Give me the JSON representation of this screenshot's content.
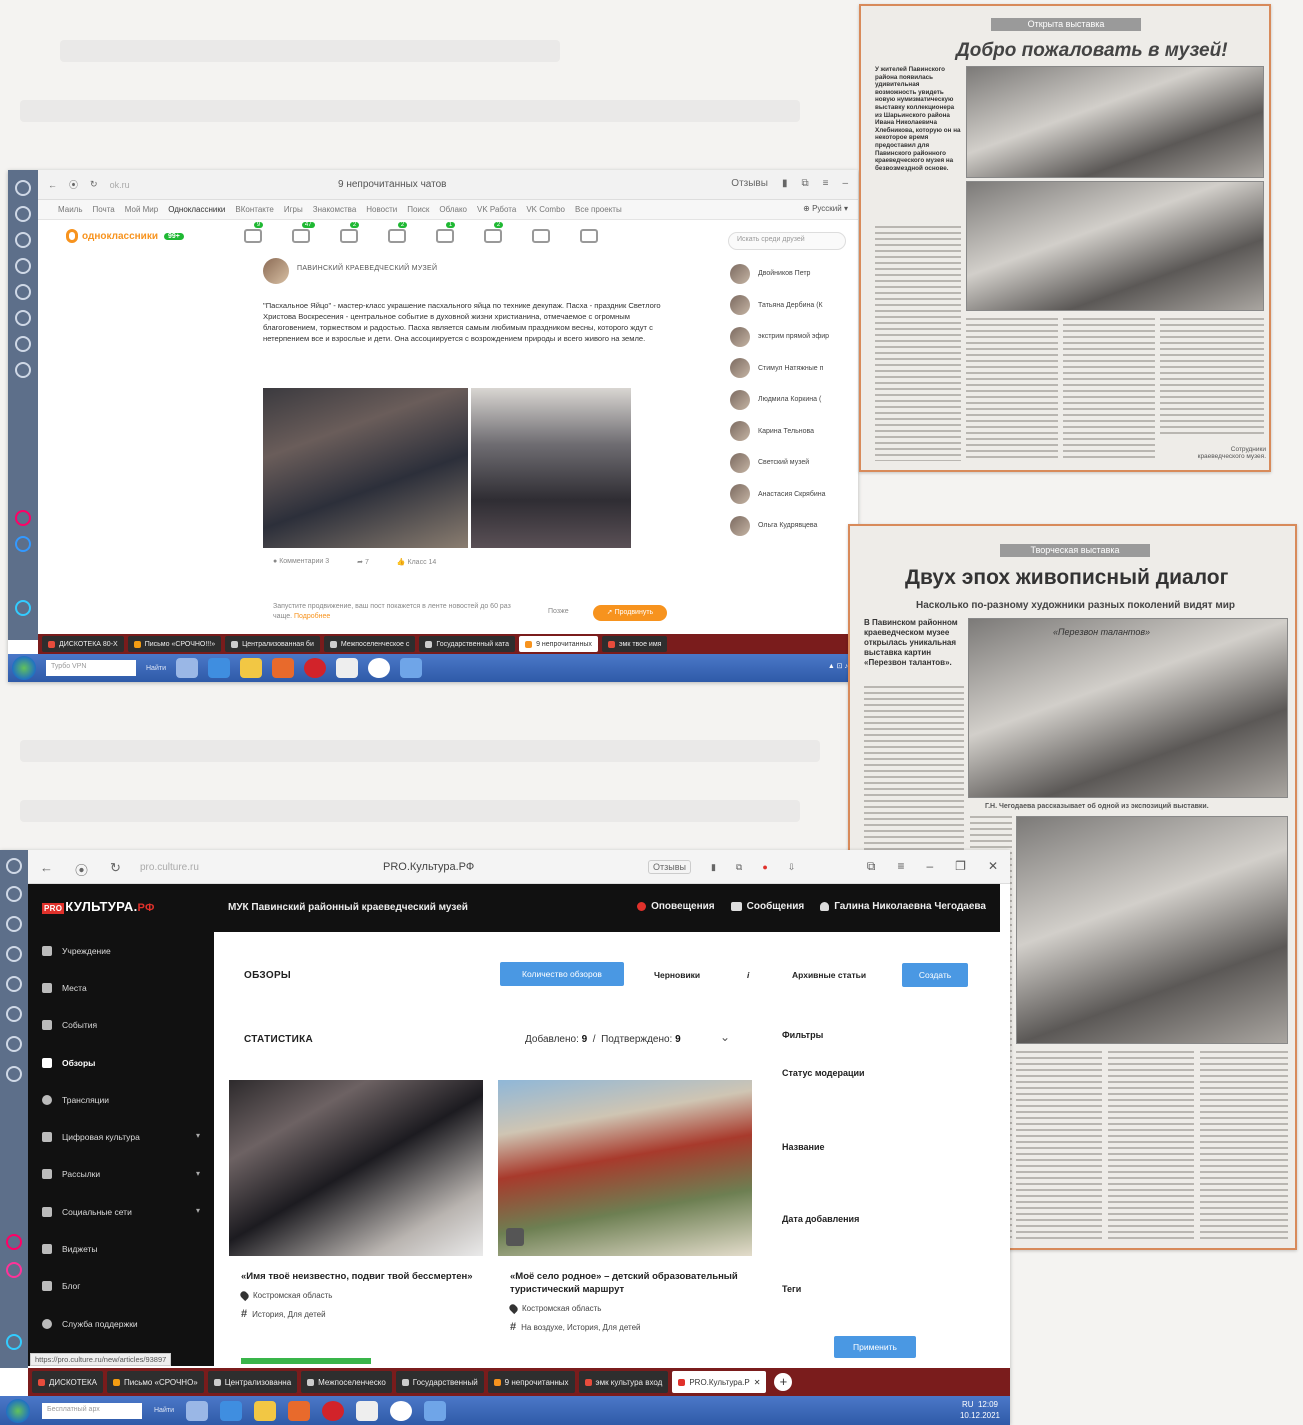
{
  "shot1": {
    "tab_title": "9 непрочитанных чатов",
    "url": "ok.ru",
    "reviews": "Отзывы",
    "bookmarks": [
      "Маиль",
      "Почта",
      "Мой Мир",
      "Одноклассники",
      "ВКонтакте",
      "Игры",
      "Знакомства",
      "Новости",
      "Поиск",
      "Облако",
      "VK Работа",
      "VK Combo",
      "Все проекты"
    ],
    "language": "Русский",
    "logo_text": "одноклассники",
    "logo_badge": "99+",
    "nav_badges": [
      "9",
      "47",
      "2",
      "2",
      "1",
      "2"
    ],
    "search_placeholder": "Искать среди друзей",
    "post_author": "ПАВИНСКИЙ КРАЕВЕДЧЕСКИЙ МУЗЕЙ",
    "post_text": "\"Пасхальное Яйцо\" - мастер-класс украшение пасхального яйца по технике декупаж. Пасха - праздник Светлого Христова Воскресения - центральное событие в духовной жизни христианина, отмечаемое с огромным благоговением, торжеством и радостью. Пасха является самым любимым праздником весны, которого ждут с нетерпением все и взрослые и дети. Она ассоциируется с возрождением природы и всего живого на земле.",
    "post_actions": {
      "comments": "Комментарии 3",
      "share": "7",
      "likes": "Класс 14"
    },
    "promo_text": "Запустите продвижение, ваш пост покажется в ленте новостей до 60 раз чаще.",
    "promo_more": "Подробнее",
    "promo_later": "Позже",
    "promo_button": "Продвинуть",
    "friends": [
      "Двойников Петр",
      "Татьяна Дербина (К",
      "экстрим прямой эфир",
      "Стимул Натяжные п",
      "Людмила Коркина (",
      "Карина Тельнова",
      "Светский музей",
      "Анастасия Скрябина",
      "Ольга Кудрявцева"
    ],
    "taskbar_tabs": [
      "ДИСКОТЕКА 80-Х",
      "Письмо «СРОЧНО!!!»",
      "Централизованная би",
      "Межпоселенческое с",
      "Государственный ката",
      "9 непрочитанных",
      "эмк твое имя"
    ],
    "win_search": "Турбо VPN",
    "win_find": "Найти"
  },
  "clip1": {
    "kicker": "Открыта выставка",
    "title": "Добро пожаловать в музей!",
    "lead": "У жителей Павинского района появилась удивительная возможность увидеть новую нумизматическую выставку коллекционера из Шарьинского района Ивана Николаевича Хлебникова, которую он на некоторое время предоставил для Павинского районного краеведческого музея на безвозмездной основе.",
    "signature": "Сотрудники краеведческого музея."
  },
  "clip2": {
    "kicker": "Творческая выставка",
    "title": "Двух эпох живописный диалог",
    "subtitle": "Насколько по-разному художники разных поколений видят мир",
    "lead": "В Павинском районном краеведческом музее открылась уникальная выставка картин «Перезвон талантов».",
    "caption": "Г.Н. Чегодаева рассказывает об одной из экспозиций выставки.",
    "banner": "«Перезвон талантов»"
  },
  "shot2": {
    "url": "pro.culture.ru",
    "tab_title": "PRO.Культура.РФ",
    "reviews": "Отзывы",
    "logo_pro": "PRO",
    "logo_main": "КУЛЬТУРА.",
    "logo_rf": "РФ",
    "org": "МУК Павинский районный краеведческий музей",
    "notifications": "Оповещения",
    "messages": "Сообщения",
    "user": "Галина Николаевна Чегодаева",
    "sidebar": [
      "Учреждение",
      "Места",
      "События",
      "Обзоры",
      "Трансляции",
      "Цифровая культура",
      "Рассылки",
      "Социальные сети",
      "Виджеты",
      "Блог",
      "Служба поддержки"
    ],
    "section_title": "ОБЗОРЫ",
    "btn_count": "Количество обзоров",
    "tab_drafts": "Черновики",
    "tab_info": "i",
    "tab_archive": "Архивные статьи",
    "btn_create": "Создать",
    "stats_title": "СТАТИСТИКА",
    "added_label": "Добавлено:",
    "added_value": "9",
    "confirmed_label": "Подтверждено:",
    "confirmed_value": "9",
    "cards": [
      {
        "title": "«Имя твоё неизвестно, подвиг твой бессмертен»",
        "region": "Костромская область",
        "tags": "История, Для детей"
      },
      {
        "title": "«Моё село родное» – детский образовательный туристический маршрут",
        "region": "Костромская область",
        "tags": "На воздухе, История, Для детей"
      }
    ],
    "filters_title": "Фильтры",
    "filter_status": "Статус модерации",
    "filter_name": "Название",
    "filter_date": "Дата добавления",
    "filter_tags": "Теги",
    "apply": "Применить",
    "status_url": "https://pro.culture.ru/new/articles/93897",
    "taskbar_tabs": [
      "ДИСКОТЕКА",
      "Письмо «СРОЧНО»",
      "Централизованна",
      "Межпоселенческо",
      "Государственный",
      "9 непрочитанных",
      "эмк культура вход",
      "PRO.Культура.Р"
    ],
    "win_search": "Бесплатный арх",
    "win_find": "Найти",
    "clock_time": "12:09",
    "clock_date": "10.12.2021",
    "lang": "RU"
  },
  "colors": {
    "ok_orange": "#f7931e",
    "pro_red": "#e0312b",
    "pro_blue": "#4a98e3",
    "clip_border": "#d88a5a"
  }
}
